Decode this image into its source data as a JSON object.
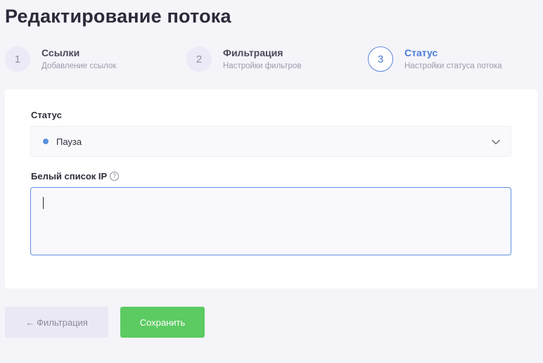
{
  "page": {
    "title": "Редактирование потока"
  },
  "steps": [
    {
      "number": "1",
      "title": "Ссылки",
      "subtitle": "Добавление ссылок",
      "active": false
    },
    {
      "number": "2",
      "title": "Фильтрация",
      "subtitle": "Настройки фильтров",
      "active": false
    },
    {
      "number": "3",
      "title": "Статус",
      "subtitle": "Настройки статуса потока",
      "active": true
    }
  ],
  "form": {
    "status_label": "Статус",
    "status_value": "Пауза",
    "status_dot_color": "#5b8fdc",
    "whitelist_label": "Белый список IP",
    "whitelist_help_icon": "question-circle-icon",
    "whitelist_value": ""
  },
  "buttons": {
    "back_arrow": "←",
    "back_label": "Фильтрация",
    "save_label": "Сохранить"
  },
  "colors": {
    "accent": "#4a7bd4",
    "save_green": "#5ccb62",
    "background": "#f5f4f9"
  }
}
